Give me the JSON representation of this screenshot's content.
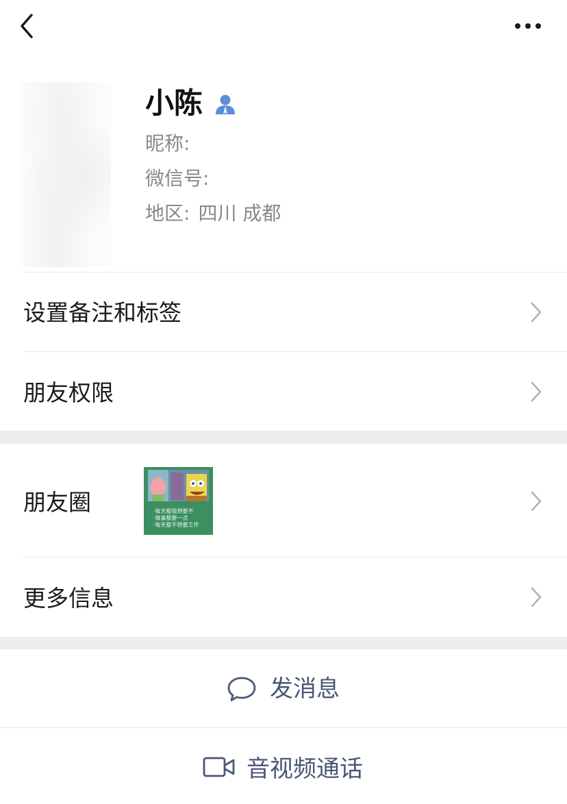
{
  "topbar": {
    "back_icon": "chevron-left-icon",
    "more_icon": "more-dots-icon"
  },
  "profile": {
    "name": "小陈",
    "contact_icon": "person-icon",
    "nickname_label": "昵称:",
    "wechat_id_label": "微信号:",
    "region_label": "地区:",
    "region_value": "四川  成都"
  },
  "menu": {
    "remark_tags": "设置备注和标签",
    "friend_permissions": "朋友权限",
    "moments": "朋友圈",
    "more_info": "更多信息"
  },
  "moments_thumb": {
    "caption_lines": [
      "·每天都很想要不",
      "·做事都要一点",
      "·每天都不想要工作"
    ]
  },
  "actions": {
    "send_message": "发消息",
    "av_call": "音视频通话"
  },
  "colors": {
    "accent_text": "#4a5677",
    "contact_icon_blue": "#5b8fd8",
    "thumb_green": "#3c8f60",
    "section_gap": "#ededed"
  }
}
